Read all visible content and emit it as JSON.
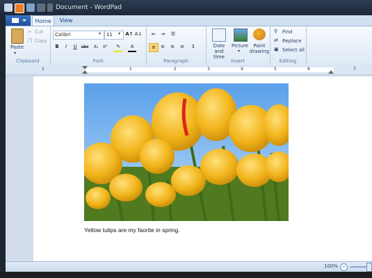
{
  "window": {
    "title": "Document - WordPad"
  },
  "tabs": [
    {
      "label": "Home"
    },
    {
      "label": "View"
    }
  ],
  "clipboard": {
    "paste": "Paste",
    "cut": "Cut",
    "copy": "Copy",
    "group": "Clipboard"
  },
  "font": {
    "family": "Calibri",
    "size": "11",
    "group": "Font",
    "format_buttons": [
      "B",
      "I",
      "U",
      "abc",
      "X₂",
      "X²"
    ]
  },
  "paragraph": {
    "group": "Paragraph"
  },
  "insert": {
    "datetime": "Date and time",
    "picture": "Picture",
    "paint": "Paint drawing",
    "group": "Insert"
  },
  "editing": {
    "find": "Find",
    "replace": "Replace",
    "select_all": "Select all",
    "group": "Editing"
  },
  "ruler": {
    "ticks": [
      "1",
      "1",
      "2",
      "3",
      "4",
      "5",
      "6",
      "7"
    ]
  },
  "document": {
    "caption": "Yellow tulips are my faorite in spring."
  },
  "status": {
    "zoom": "100%"
  },
  "colors": {
    "accent": "#3b74c6",
    "ribbon": "#dde9f5",
    "tulip_yellow": "#f2b51c",
    "sky": "#6aa7e8",
    "stem_green": "#4f7a1f"
  }
}
